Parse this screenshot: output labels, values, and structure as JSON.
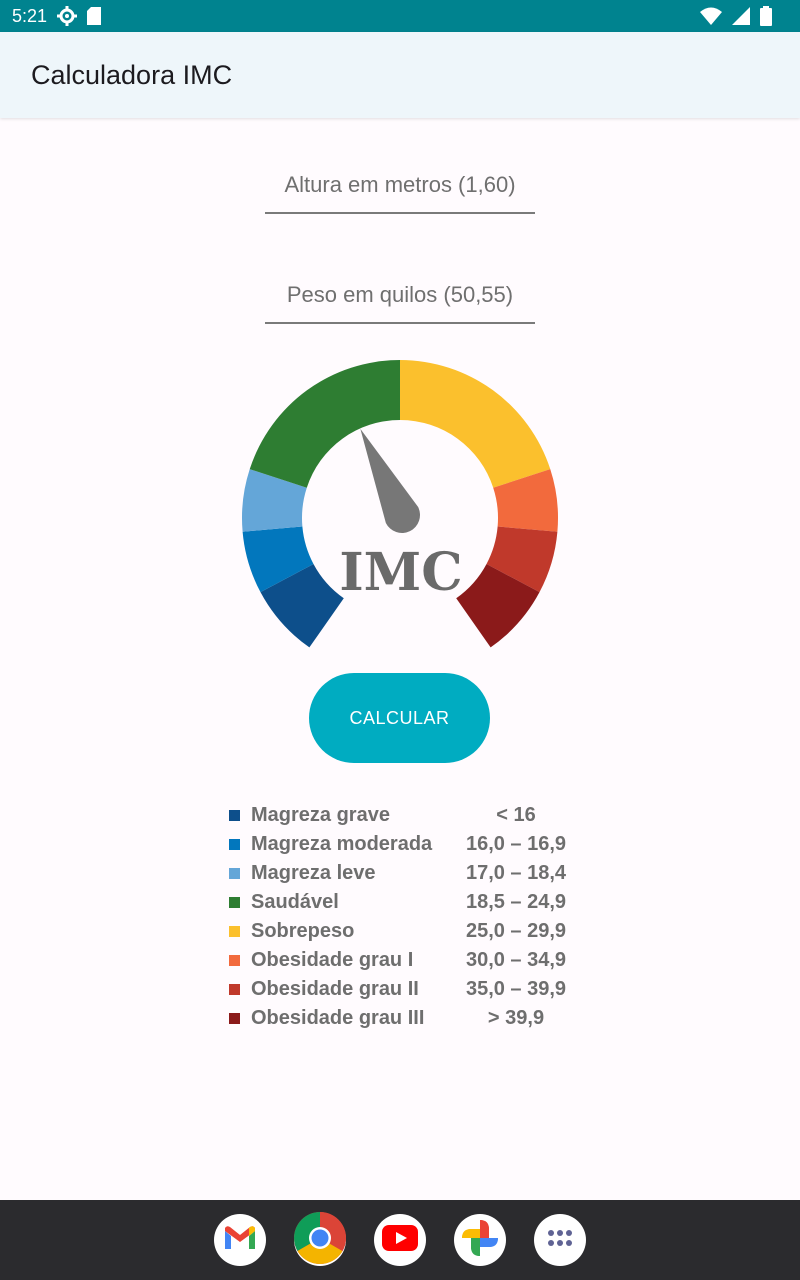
{
  "status_bar": {
    "time": "5:21"
  },
  "app_bar": {
    "title": "Calculadora IMC"
  },
  "inputs": {
    "height": {
      "placeholder": "Altura em metros (1,60)",
      "value": ""
    },
    "weight": {
      "placeholder": "Peso em quilos (50,55)",
      "value": ""
    }
  },
  "gauge": {
    "label": "IMC",
    "needle_category_index": 3,
    "segment_colors": [
      "#0d4f8b",
      "#0277bd",
      "#64a6d8",
      "#2e7d32",
      "#fbc02d",
      "#f26a3d",
      "#c0392b",
      "#8b1a1a"
    ]
  },
  "button": {
    "label": "CALCULAR"
  },
  "legend": [
    {
      "label": "Magreza grave",
      "range": "< 16",
      "color": "#0d4f8b"
    },
    {
      "label": "Magreza moderada",
      "range": "16,0 – 16,9",
      "color": "#0277bd"
    },
    {
      "label": "Magreza leve",
      "range": "17,0 – 18,4",
      "color": "#64a6d8"
    },
    {
      "label": "Saudável",
      "range": "18,5 – 24,9",
      "color": "#2e7d32"
    },
    {
      "label": "Sobrepeso",
      "range": "25,0 – 29,9",
      "color": "#fbc02d"
    },
    {
      "label": "Obesidade grau I",
      "range": "30,0 – 34,9",
      "color": "#f26a3d"
    },
    {
      "label": "Obesidade grau II",
      "range": "35,0 – 39,9",
      "color": "#c0392b"
    },
    {
      "label": "Obesidade grau III",
      "range": "> 39,9",
      "color": "#8b1a1a"
    }
  ],
  "dock": {
    "apps": [
      {
        "icon": "gmail-icon"
      },
      {
        "icon": "chrome-icon"
      },
      {
        "icon": "youtube-icon"
      },
      {
        "icon": "photos-icon"
      },
      {
        "icon": "app-drawer-icon"
      }
    ]
  }
}
